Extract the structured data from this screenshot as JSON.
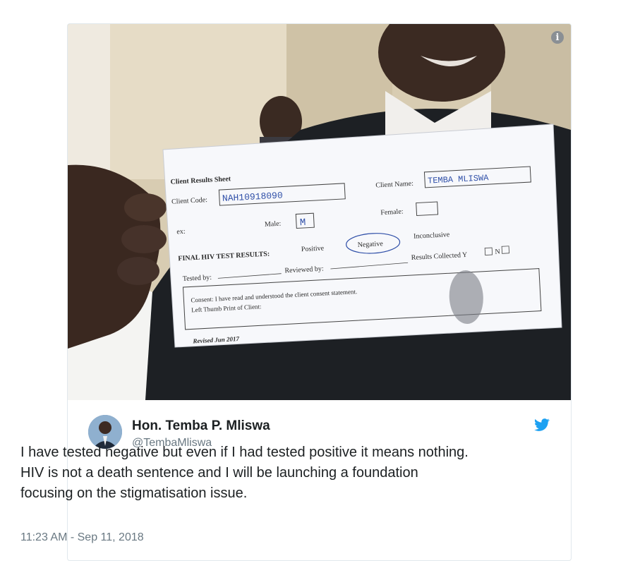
{
  "photo": {
    "form": {
      "title": "Client Results Sheet",
      "client_code_label": "Client Code:",
      "client_code_value": "NAH10918090",
      "client_name_label": "Client Name:",
      "client_name_value": "TEMBA MLISWA",
      "sex_label": "ex:",
      "male_label": "Male:",
      "male_value": "M",
      "female_label": "Female:",
      "final_label": "FINAL HIV TEST RESULTS:",
      "positive": "Positive",
      "negative": "Negative",
      "inconclusive": "Inconclusive",
      "tested_by": "Tested by:",
      "reviewed_by": "Reviewed by:",
      "results_collected": "Results Collected  Y",
      "results_collected_n": "N",
      "consent_text": "Consent: I have read and understood the client consent statement.",
      "thumb_label": "Left Thumb Print of Client:",
      "revised": "Revised Jun 2017"
    }
  },
  "info_icon": "info-icon",
  "user": {
    "name": "Hon. Temba P. Mliswa",
    "handle": "@TembaMliswa"
  },
  "twitter_logo": "twitter-bird-icon",
  "tweet": {
    "text": "I have tested negative but even if I had tested positive it means nothing. HIV is not a death sentence  and I will be launching a foundation focusing on the stigmatisation issue.",
    "timestamp": "11:23 AM - Sep 11, 2018"
  },
  "colors": {
    "twitter_blue": "#1da1f2",
    "text": "#1c2022",
    "muted": "#697882"
  }
}
